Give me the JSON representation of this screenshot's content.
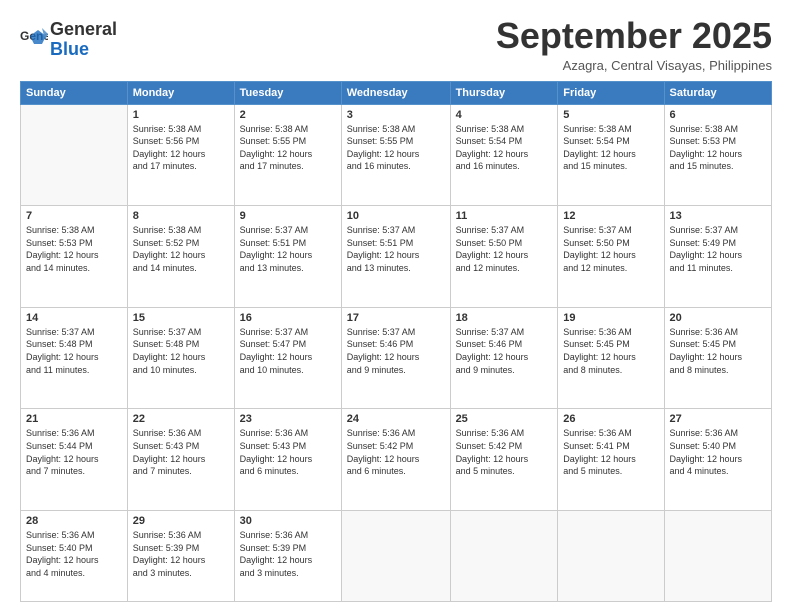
{
  "logo": {
    "text_general": "General",
    "text_blue": "Blue"
  },
  "header": {
    "month_year": "September 2025",
    "location": "Azagra, Central Visayas, Philippines"
  },
  "weekdays": [
    "Sunday",
    "Monday",
    "Tuesday",
    "Wednesday",
    "Thursday",
    "Friday",
    "Saturday"
  ],
  "weeks": [
    [
      {
        "day": "",
        "info": ""
      },
      {
        "day": "1",
        "info": "Sunrise: 5:38 AM\nSunset: 5:56 PM\nDaylight: 12 hours\nand 17 minutes."
      },
      {
        "day": "2",
        "info": "Sunrise: 5:38 AM\nSunset: 5:55 PM\nDaylight: 12 hours\nand 17 minutes."
      },
      {
        "day": "3",
        "info": "Sunrise: 5:38 AM\nSunset: 5:55 PM\nDaylight: 12 hours\nand 16 minutes."
      },
      {
        "day": "4",
        "info": "Sunrise: 5:38 AM\nSunset: 5:54 PM\nDaylight: 12 hours\nand 16 minutes."
      },
      {
        "day": "5",
        "info": "Sunrise: 5:38 AM\nSunset: 5:54 PM\nDaylight: 12 hours\nand 15 minutes."
      },
      {
        "day": "6",
        "info": "Sunrise: 5:38 AM\nSunset: 5:53 PM\nDaylight: 12 hours\nand 15 minutes."
      }
    ],
    [
      {
        "day": "7",
        "info": "Sunrise: 5:38 AM\nSunset: 5:53 PM\nDaylight: 12 hours\nand 14 minutes."
      },
      {
        "day": "8",
        "info": "Sunrise: 5:38 AM\nSunset: 5:52 PM\nDaylight: 12 hours\nand 14 minutes."
      },
      {
        "day": "9",
        "info": "Sunrise: 5:37 AM\nSunset: 5:51 PM\nDaylight: 12 hours\nand 13 minutes."
      },
      {
        "day": "10",
        "info": "Sunrise: 5:37 AM\nSunset: 5:51 PM\nDaylight: 12 hours\nand 13 minutes."
      },
      {
        "day": "11",
        "info": "Sunrise: 5:37 AM\nSunset: 5:50 PM\nDaylight: 12 hours\nand 12 minutes."
      },
      {
        "day": "12",
        "info": "Sunrise: 5:37 AM\nSunset: 5:50 PM\nDaylight: 12 hours\nand 12 minutes."
      },
      {
        "day": "13",
        "info": "Sunrise: 5:37 AM\nSunset: 5:49 PM\nDaylight: 12 hours\nand 11 minutes."
      }
    ],
    [
      {
        "day": "14",
        "info": "Sunrise: 5:37 AM\nSunset: 5:48 PM\nDaylight: 12 hours\nand 11 minutes."
      },
      {
        "day": "15",
        "info": "Sunrise: 5:37 AM\nSunset: 5:48 PM\nDaylight: 12 hours\nand 10 minutes."
      },
      {
        "day": "16",
        "info": "Sunrise: 5:37 AM\nSunset: 5:47 PM\nDaylight: 12 hours\nand 10 minutes."
      },
      {
        "day": "17",
        "info": "Sunrise: 5:37 AM\nSunset: 5:46 PM\nDaylight: 12 hours\nand 9 minutes."
      },
      {
        "day": "18",
        "info": "Sunrise: 5:37 AM\nSunset: 5:46 PM\nDaylight: 12 hours\nand 9 minutes."
      },
      {
        "day": "19",
        "info": "Sunrise: 5:36 AM\nSunset: 5:45 PM\nDaylight: 12 hours\nand 8 minutes."
      },
      {
        "day": "20",
        "info": "Sunrise: 5:36 AM\nSunset: 5:45 PM\nDaylight: 12 hours\nand 8 minutes."
      }
    ],
    [
      {
        "day": "21",
        "info": "Sunrise: 5:36 AM\nSunset: 5:44 PM\nDaylight: 12 hours\nand 7 minutes."
      },
      {
        "day": "22",
        "info": "Sunrise: 5:36 AM\nSunset: 5:43 PM\nDaylight: 12 hours\nand 7 minutes."
      },
      {
        "day": "23",
        "info": "Sunrise: 5:36 AM\nSunset: 5:43 PM\nDaylight: 12 hours\nand 6 minutes."
      },
      {
        "day": "24",
        "info": "Sunrise: 5:36 AM\nSunset: 5:42 PM\nDaylight: 12 hours\nand 6 minutes."
      },
      {
        "day": "25",
        "info": "Sunrise: 5:36 AM\nSunset: 5:42 PM\nDaylight: 12 hours\nand 5 minutes."
      },
      {
        "day": "26",
        "info": "Sunrise: 5:36 AM\nSunset: 5:41 PM\nDaylight: 12 hours\nand 5 minutes."
      },
      {
        "day": "27",
        "info": "Sunrise: 5:36 AM\nSunset: 5:40 PM\nDaylight: 12 hours\nand 4 minutes."
      }
    ],
    [
      {
        "day": "28",
        "info": "Sunrise: 5:36 AM\nSunset: 5:40 PM\nDaylight: 12 hours\nand 4 minutes."
      },
      {
        "day": "29",
        "info": "Sunrise: 5:36 AM\nSunset: 5:39 PM\nDaylight: 12 hours\nand 3 minutes."
      },
      {
        "day": "30",
        "info": "Sunrise: 5:36 AM\nSunset: 5:39 PM\nDaylight: 12 hours\nand 3 minutes."
      },
      {
        "day": "",
        "info": ""
      },
      {
        "day": "",
        "info": ""
      },
      {
        "day": "",
        "info": ""
      },
      {
        "day": "",
        "info": ""
      }
    ]
  ]
}
